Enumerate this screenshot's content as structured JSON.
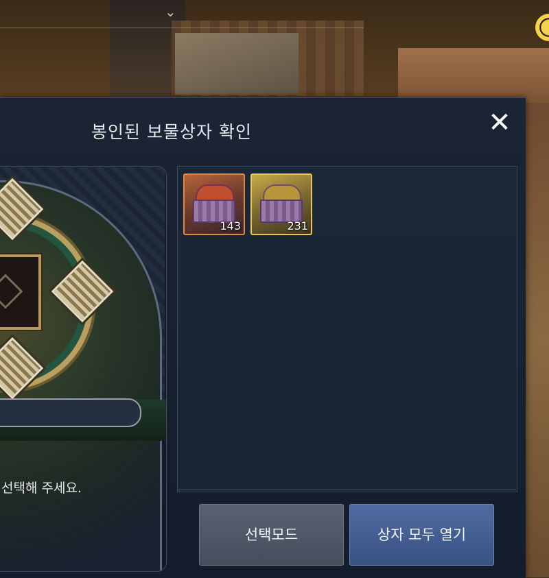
{
  "dialog": {
    "title": "봉인된 보물상자 확인",
    "close_label": "✕"
  },
  "left_panel": {
    "hint_text": "선택해 주세요."
  },
  "inventory": {
    "items": [
      {
        "name": "red-treasure-chest",
        "count": "143",
        "border_color": "#e08a40"
      },
      {
        "name": "gold-treasure-chest",
        "count": "231",
        "border_color": "#e6c65a"
      }
    ]
  },
  "buttons": {
    "select_mode": "선택모드",
    "open_all": "상자 모두 열기"
  },
  "hud": {
    "chevron": "⌄",
    "coin_icon": "gold-coin-icon"
  }
}
